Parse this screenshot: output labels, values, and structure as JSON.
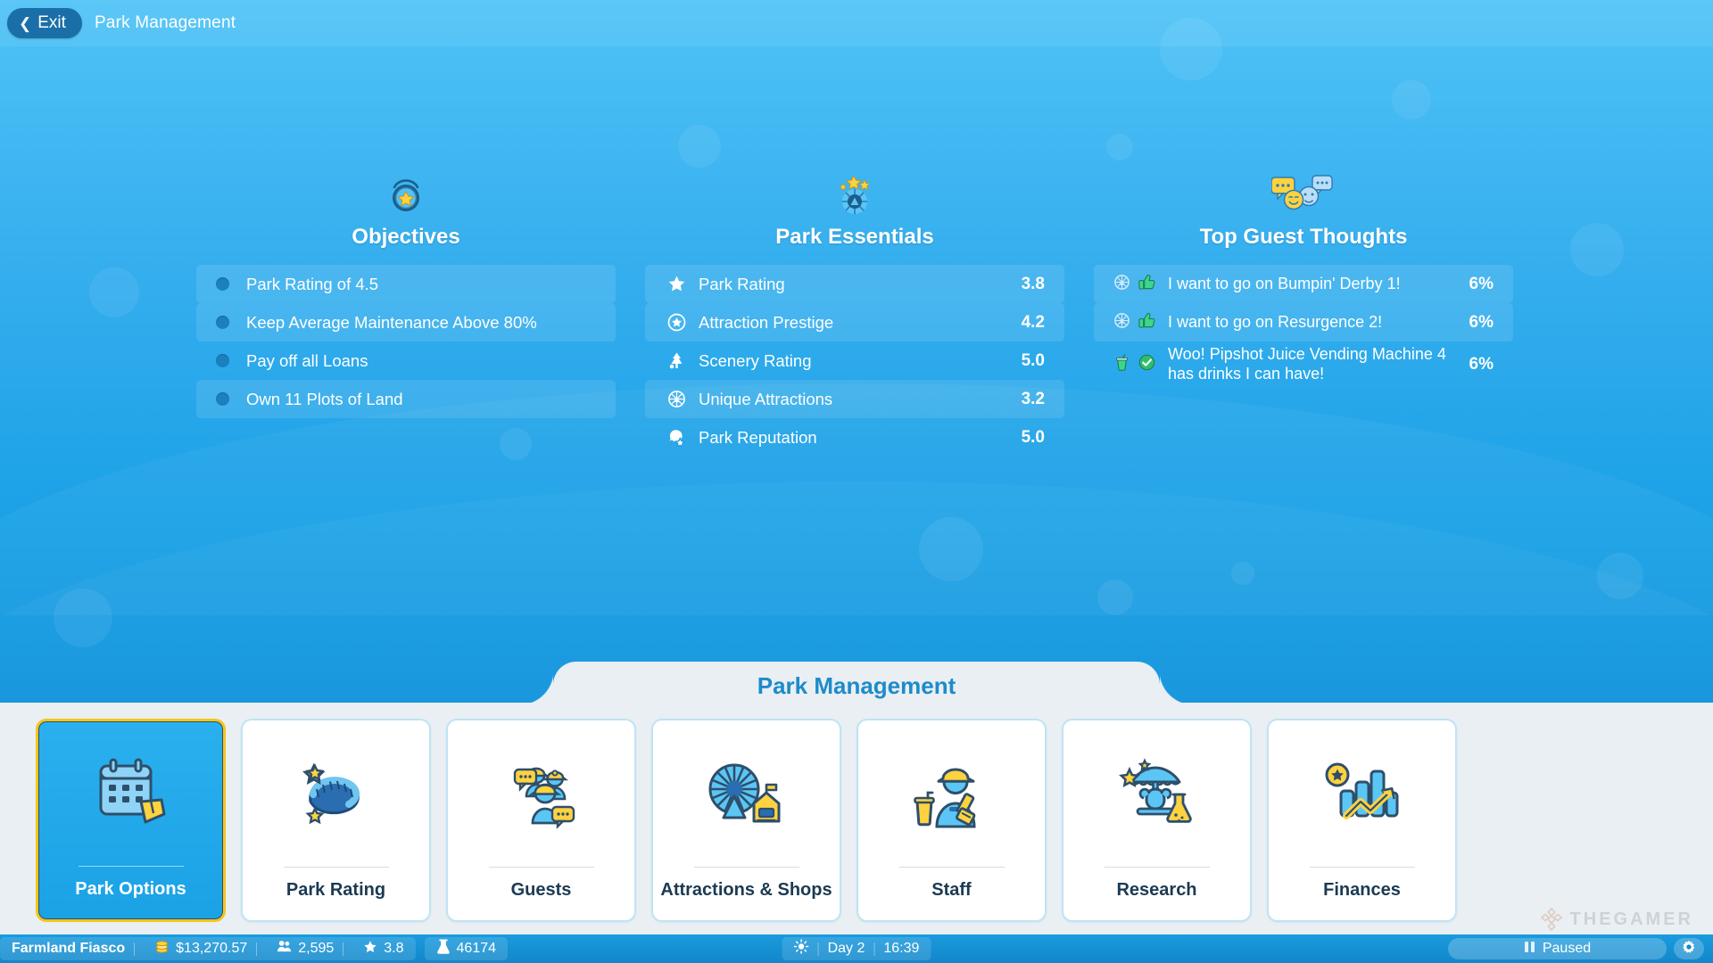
{
  "topbar": {
    "exit_label": "Exit",
    "back_icon": "chevron-left-icon",
    "breadcrumb": "Park Management"
  },
  "objectives": {
    "icon": "star-badge-icon",
    "title": "Objectives",
    "items": [
      {
        "label": "Park Rating of 4.5"
      },
      {
        "label": "Keep Average Maintenance Above 80%"
      },
      {
        "label": "Pay off all Loans"
      },
      {
        "label": "Own 11 Plots of Land"
      }
    ]
  },
  "park_essentials": {
    "icon": "ferris-wheel-stars-icon",
    "title": "Park Essentials",
    "items": [
      {
        "icon": "star-icon",
        "label": "Park Rating",
        "value": "3.8"
      },
      {
        "icon": "prestige-circle-icon",
        "label": "Attraction Prestige",
        "value": "4.2"
      },
      {
        "icon": "tree-icon",
        "label": "Scenery Rating",
        "value": "5.0"
      },
      {
        "icon": "ferris-wheel-icon",
        "label": "Unique Attractions",
        "value": "3.2"
      },
      {
        "icon": "reputation-icon",
        "label": "Park Reputation",
        "value": "5.0"
      }
    ]
  },
  "guest_thoughts": {
    "icon": "speech-bubbles-icon",
    "title": "Top Guest Thoughts",
    "items": [
      {
        "subject_icon": "ferris-wheel-icon",
        "mood_icon": "thumbs-up-icon",
        "text": "I want to go on Bumpin' Derby 1!",
        "percent": "6%"
      },
      {
        "subject_icon": "ferris-wheel-icon",
        "mood_icon": "thumbs-up-icon",
        "text": "I want to go on Resurgence 2!",
        "percent": "6%"
      },
      {
        "subject_icon": "drink-cup-icon",
        "mood_icon": "check-circle-icon",
        "text": "Woo! Pipshot Juice Vending Machine 4 has drinks I can have!",
        "percent": "6%"
      }
    ]
  },
  "panel": {
    "title": "Park Management",
    "tiles": [
      {
        "label": "Park Options",
        "icon": "calendar-ticket-icon",
        "selected": true
      },
      {
        "label": "Park Rating",
        "icon": "rollercoaster-stars-icon",
        "selected": false
      },
      {
        "label": "Guests",
        "icon": "guests-group-icon",
        "selected": false
      },
      {
        "label": "Attractions & Shops",
        "icon": "ferris-wheel-shop-icon",
        "selected": false
      },
      {
        "label": "Staff",
        "icon": "janitor-icon",
        "selected": false
      },
      {
        "label": "Research",
        "icon": "carousel-flask-icon",
        "selected": false
      },
      {
        "label": "Finances",
        "icon": "bar-chart-coin-icon",
        "selected": false
      }
    ]
  },
  "statusbar": {
    "park_name": "Farmland Fiasco",
    "money_icon": "coins-icon",
    "money": "$13,270.57",
    "guests_icon": "guests-icon",
    "guests": "2,595",
    "rating_icon": "star-icon",
    "rating": "3.8",
    "research_icon": "flask-icon",
    "research": "46174",
    "weather_icon": "sun-icon",
    "day": "Day 2",
    "time": "16:39",
    "pause_icon": "pause-icon",
    "pause_label": "Paused",
    "settings_icon": "gear-icon"
  },
  "watermark": {
    "text": "THEGAMER",
    "icon": "thegamer-logo-icon"
  },
  "colors": {
    "accent_blue": "#1E8BC9",
    "selected_tile": "#1AA2E6",
    "selected_border": "#F5C518",
    "panel_bg": "#E9EFF3",
    "tile_border": "#BFE3F6"
  }
}
